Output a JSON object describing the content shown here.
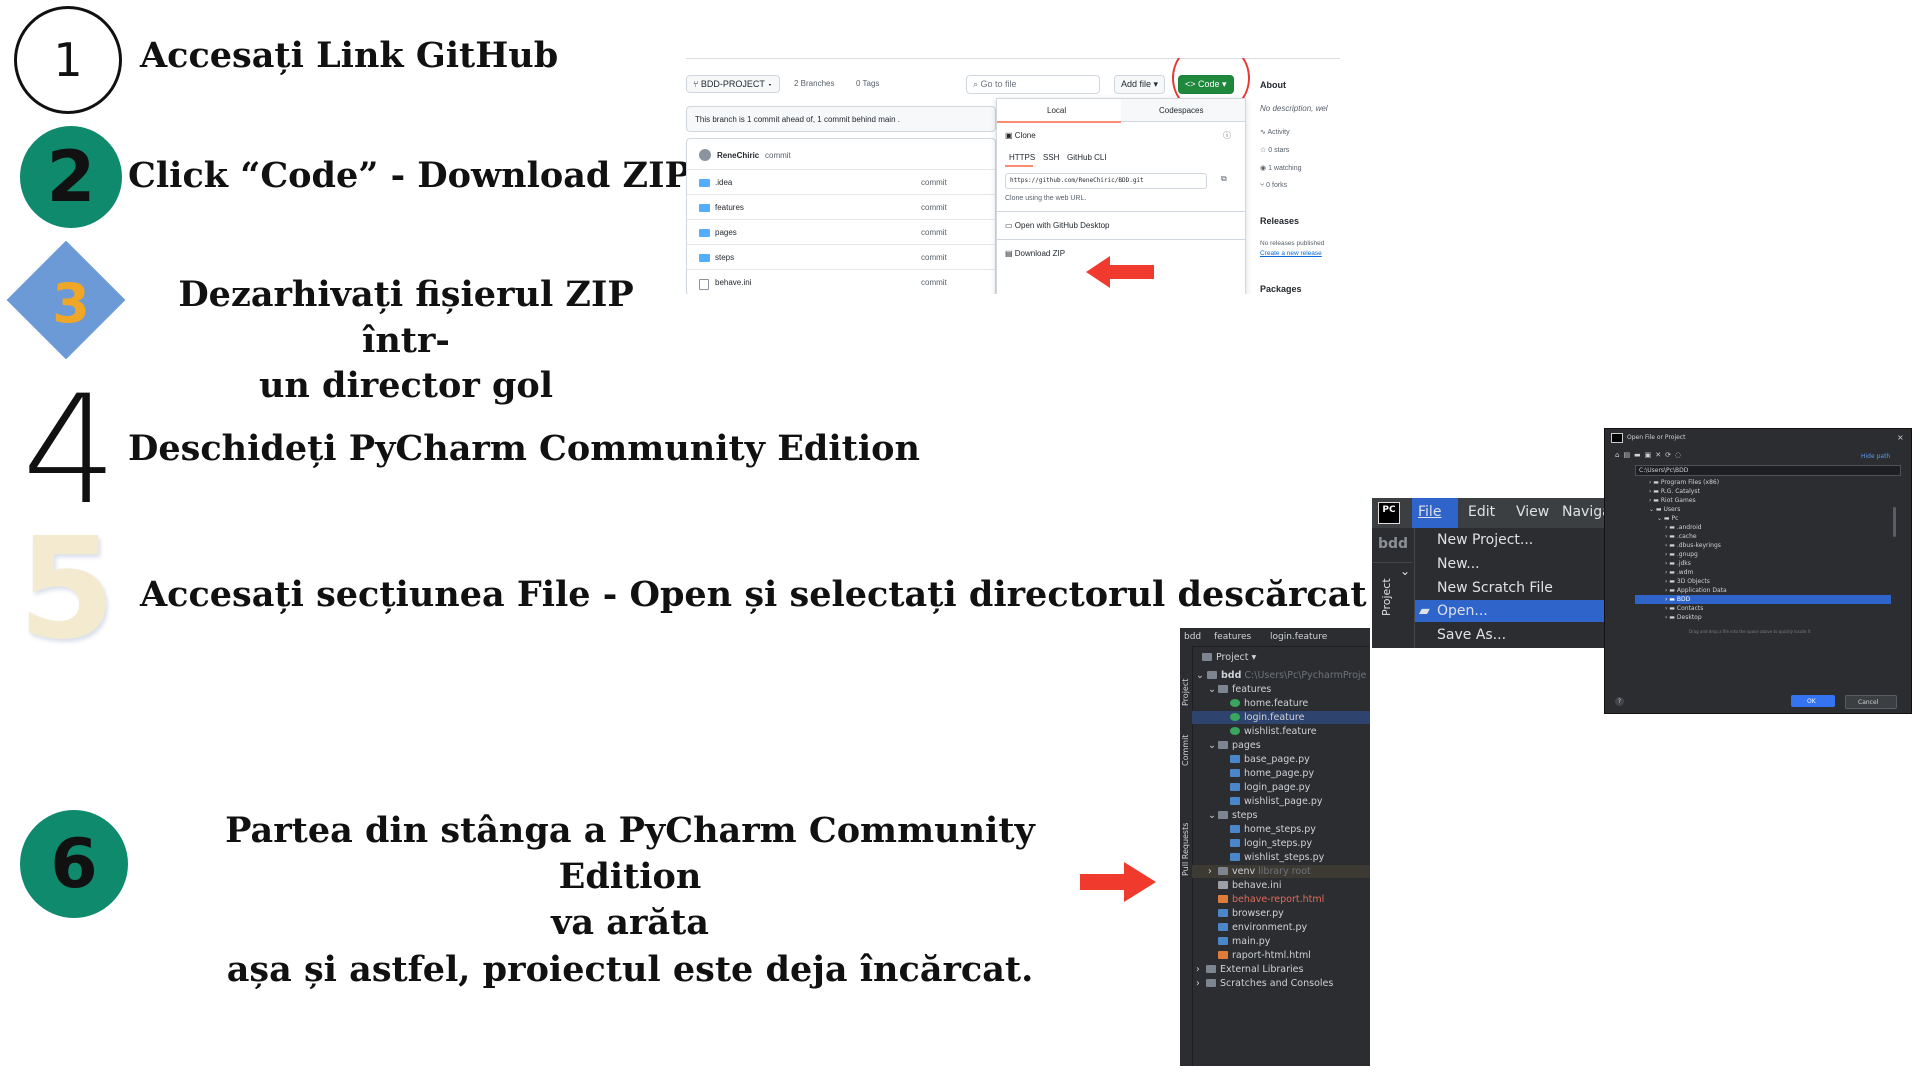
{
  "steps": [
    {
      "number": "1",
      "text": "Accesați Link GitHub"
    },
    {
      "number": "2",
      "text": "Click “Code” - Download ZIP"
    },
    {
      "number": "3",
      "line1": "Dezarhivați fișierul ZIP într-",
      "line2": "un director gol"
    },
    {
      "number": "4",
      "text": "Deschideți PyCharm Community Edition"
    },
    {
      "number": "5",
      "text": "Accesați secțiunea File - Open și selectați directorul descărcat"
    },
    {
      "number": "6",
      "line1": "Partea din stânga a PyCharm Community Edition",
      "line2": "va arăta",
      "line3": "așa și astfel, proiectul este deja încărcat."
    }
  ],
  "github": {
    "branch": "BDD-PROJECT",
    "branches": "2 Branches",
    "tags": "0 Tags",
    "search_placeholder": "Go to file",
    "add_file": "Add file",
    "code_button": "Code",
    "ahead_text": "This branch is 1 commit ahead of, 1 commit behind main .",
    "author": "ReneChiric",
    "author_commit": "commit",
    "files": [
      {
        "name": ".idea",
        "commit": "commit"
      },
      {
        "name": "features",
        "commit": "commit"
      },
      {
        "name": "pages",
        "commit": "commit"
      },
      {
        "name": "steps",
        "commit": "commit"
      },
      {
        "name": "behave.ini",
        "commit": "commit"
      }
    ],
    "dropdown": {
      "tab_local": "Local",
      "tab_codespaces": "Codespaces",
      "clone": "Clone",
      "protocols": [
        "HTTPS",
        "SSH",
        "GitHub CLI"
      ],
      "url": "https://github.com/ReneChiric/BDD.git",
      "url_hint": "Clone using the web URL.",
      "open_desktop": "Open with GitHub Desktop",
      "download_zip": "Download ZIP"
    },
    "about": {
      "title": "About",
      "description": "No description, wel",
      "stats": [
        "Activity",
        "0 stars",
        "1 watching",
        "0 forks"
      ],
      "releases_title": "Releases",
      "releases_text": "No releases published",
      "releases_link": "Create a new release",
      "packages_title": "Packages"
    },
    "colors": {
      "code_button": "#1f883d",
      "highlight_circle": "#e53935",
      "arrow": "#f03a2e"
    }
  },
  "pycharm_menu": {
    "logo": "PC",
    "menu_items": [
      "File",
      "Edit",
      "View",
      "Naviga"
    ],
    "project_label": "bdd",
    "side_tab": "Project",
    "entries": [
      "New Project...",
      "New...",
      "New Scratch File",
      "Open...",
      "Save As..."
    ],
    "highlighted": "Open..."
  },
  "open_dialog": {
    "title": "Open File or Project",
    "hide_path": "Hide path",
    "path": "C:\\Users\\Pc\\BDD",
    "items": [
      "Program Files (x86)",
      "R.G. Catalyst",
      "Riot Games",
      "Users",
      "Pc",
      ".android",
      ".cache",
      ".dbus-keyrings",
      ".gnupg",
      ".jdks",
      ".wdm",
      "3D Objects",
      "Application Data",
      "BDD",
      "Contacts",
      "Desktop"
    ],
    "hint": "Drag and drop a file into the space above to quickly locate it",
    "ok": "OK",
    "cancel": "Cancel",
    "help": "?"
  },
  "project_tree": {
    "breadcrumb": [
      "bdd",
      "features",
      "login.feature"
    ],
    "header": "Project",
    "side_tabs": [
      "Project",
      "Commit",
      "Pull Requests"
    ],
    "root": "bdd",
    "root_path": "C:\\Users\\Pc\\PycharmProje",
    "nodes": [
      {
        "label": "features",
        "kind": "folder",
        "level": 1
      },
      {
        "label": "home.feature",
        "kind": "feature",
        "level": 2
      },
      {
        "label": "login.feature",
        "kind": "feature",
        "level": 2
      },
      {
        "label": "wishlist.feature",
        "kind": "feature",
        "level": 2
      },
      {
        "label": "pages",
        "kind": "folder",
        "level": 1
      },
      {
        "label": "base_page.py",
        "kind": "py",
        "level": 2
      },
      {
        "label": "home_page.py",
        "kind": "py",
        "level": 2
      },
      {
        "label": "login_page.py",
        "kind": "py",
        "level": 2
      },
      {
        "label": "wishlist_page.py",
        "kind": "py",
        "level": 2
      },
      {
        "label": "steps",
        "kind": "folder",
        "level": 1
      },
      {
        "label": "home_steps.py",
        "kind": "py",
        "level": 2
      },
      {
        "label": "login_steps.py",
        "kind": "py",
        "level": 2
      },
      {
        "label": "wishlist_steps.py",
        "kind": "py",
        "level": 2
      },
      {
        "label": "venv",
        "kind": "folder",
        "level": 1,
        "suffix": "library root"
      },
      {
        "label": "behave.ini",
        "kind": "ini",
        "level": 1
      },
      {
        "label": "behave-report.html",
        "kind": "html",
        "level": 1
      },
      {
        "label": "browser.py",
        "kind": "py",
        "level": 1
      },
      {
        "label": "environment.py",
        "kind": "py",
        "level": 1
      },
      {
        "label": "main.py",
        "kind": "py",
        "level": 1
      },
      {
        "label": "raport-html.html",
        "kind": "html",
        "level": 1
      },
      {
        "label": "External Libraries",
        "kind": "folder",
        "level": 0
      },
      {
        "label": "Scratches and Consoles",
        "kind": "folder",
        "level": 0
      }
    ],
    "selected": "login.feature"
  }
}
